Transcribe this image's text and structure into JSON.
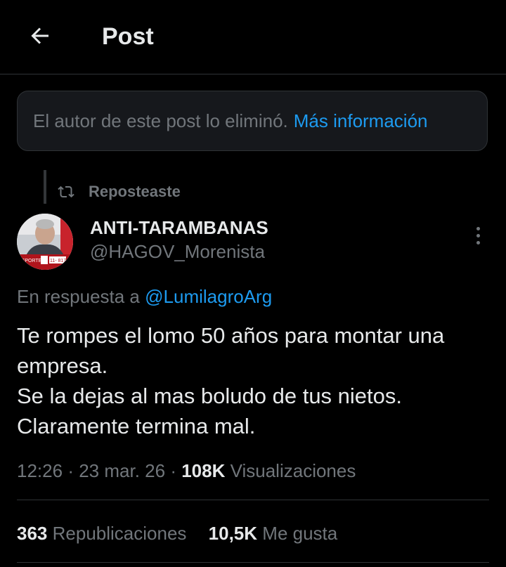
{
  "header": {
    "title": "Post",
    "back_icon": "arrow-left-icon"
  },
  "notice": {
    "text": "El autor de este post lo eliminó.",
    "link": "Más información"
  },
  "repost": {
    "icon": "repost-icon",
    "label": "Reposteaste"
  },
  "author": {
    "name": "ANTI-TARAMBANAS",
    "handle": "@HAGOV_Morenista",
    "avatar_caption_1": "ASPORTE",
    "avatar_caption_2": "11- 817"
  },
  "reply": {
    "prefix": "En respuesta a",
    "mention": "@LumilagroArg"
  },
  "post": {
    "lines": [
      "Te rompes el lomo 50 años para montar una",
      "empresa.",
      "Se la dejas al mas boludo de tus nietos.",
      "Claramente termina mal."
    ]
  },
  "meta": {
    "time": "12:26",
    "dot": "·",
    "date": "23 mar. 26",
    "views_count": "108K",
    "views_label": "Visualizaciones"
  },
  "stats": {
    "reposts_count": "363",
    "reposts_label": "Republicaciones",
    "likes_count": "10,5K",
    "likes_label": "Me gusta"
  },
  "colors": {
    "background": "#000000",
    "accent": "#1d9bf0",
    "muted": "#71767b",
    "text": "#e7e9ea",
    "border": "#2f3336"
  }
}
